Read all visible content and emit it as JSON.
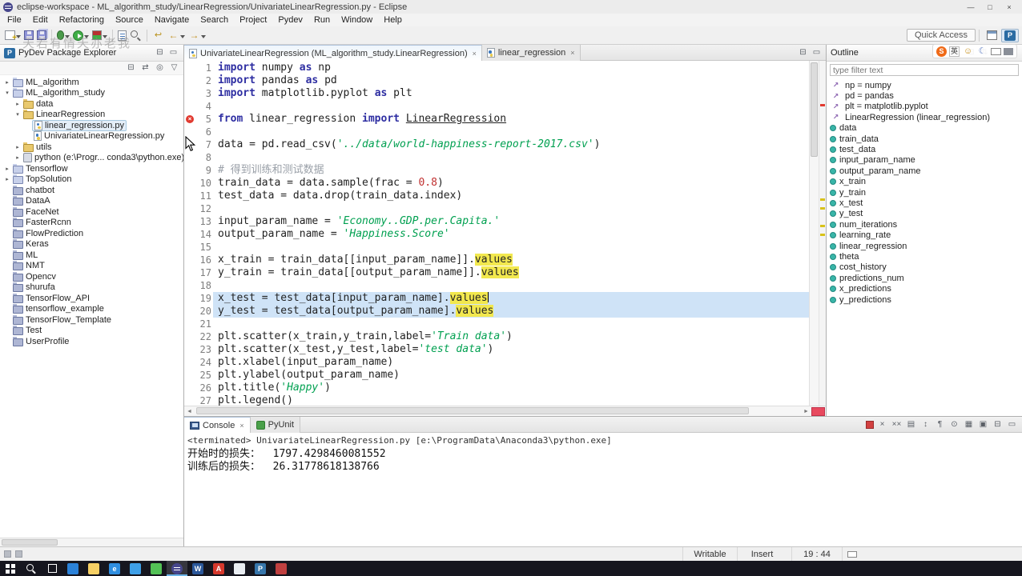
{
  "window": {
    "title": "eclipse-workspace - ML_algorithm_study/LinearRegression/UnivariateLinearRegression.py - Eclipse"
  },
  "menu": {
    "items": [
      "File",
      "Edit",
      "Refactoring",
      "Source",
      "Navigate",
      "Search",
      "Project",
      "Pydev",
      "Run",
      "Window",
      "Help"
    ]
  },
  "toolbar": {
    "quick_access": "Quick Access",
    "items": [
      {
        "name": "new-wizard-icon",
        "caret": true
      },
      {
        "name": "save-icon"
      },
      {
        "name": "save-all-icon"
      },
      {
        "sep": true
      },
      {
        "name": "debug-icon",
        "caret": true
      },
      {
        "name": "run-icon",
        "caret": true
      },
      {
        "name": "coverage-icon",
        "caret": true
      },
      {
        "sep": true
      },
      {
        "name": "new-module-icon"
      },
      {
        "name": "search-icon"
      },
      {
        "sep": true
      },
      {
        "name": "last-edit-icon"
      },
      {
        "name": "back-icon",
        "caret": true
      },
      {
        "name": "forward-icon",
        "caret": true
      }
    ],
    "perspectives": [
      {
        "name": "open-perspective-icon"
      },
      {
        "name": "pydev-perspective-icon",
        "active": true
      }
    ]
  },
  "watermark": "天若有情天亦老我",
  "ime": {
    "language": "英",
    "items": [
      "sogou-logo-icon",
      "language-mode-icon",
      "emoji-icon",
      "night-mode-icon",
      "soft-keyboard-icon",
      "toolbox-icon"
    ]
  },
  "explorer": {
    "title": "PyDev Package Explorer",
    "header_controls": [
      "minimize-view-icon",
      "maximize-view-icon"
    ],
    "toolbar": [
      "collapse-all-icon",
      "link-with-editor-icon",
      "focus-icon",
      "view-menu-icon"
    ],
    "items": [
      {
        "label": "ML_algorithm",
        "level": 0,
        "arrow": "right",
        "icon": "project"
      },
      {
        "label": "ML_algorithm_study",
        "level": 0,
        "arrow": "down",
        "icon": "project"
      },
      {
        "label": "data",
        "level": 1,
        "arrow": "right",
        "icon": "folder"
      },
      {
        "label": "LinearRegression",
        "level": 1,
        "arrow": "down",
        "icon": "folder"
      },
      {
        "label": "linear_regression.py",
        "level": 2,
        "icon": "pyfile",
        "selected": true
      },
      {
        "label": "UnivariateLinearRegression.py",
        "level": 2,
        "icon": "pyfile"
      },
      {
        "label": "utils",
        "level": 1,
        "arrow": "right",
        "icon": "folder"
      },
      {
        "label": "python (e:\\Progr... conda3\\python.exe)",
        "level": 1,
        "arrow": "right",
        "icon": "interpreter"
      },
      {
        "label": "Tensorflow",
        "level": 0,
        "arrow": "right",
        "icon": "project"
      },
      {
        "label": "TopSolution",
        "level": 0,
        "arrow": "right",
        "icon": "project"
      },
      {
        "label": "chatbot",
        "level": 0,
        "icon": "closed"
      },
      {
        "label": "DataA",
        "level": 0,
        "icon": "closed"
      },
      {
        "label": "FaceNet",
        "level": 0,
        "icon": "closed"
      },
      {
        "label": "FasterRcnn",
        "level": 0,
        "icon": "closed"
      },
      {
        "label": "FlowPrediction",
        "level": 0,
        "icon": "closed"
      },
      {
        "label": "Keras",
        "level": 0,
        "icon": "closed"
      },
      {
        "label": "ML",
        "level": 0,
        "icon": "closed"
      },
      {
        "label": "NMT",
        "level": 0,
        "icon": "closed"
      },
      {
        "label": "Opencv",
        "level": 0,
        "icon": "closed"
      },
      {
        "label": "shurufa",
        "level": 0,
        "icon": "closed"
      },
      {
        "label": "TensorFlow_API",
        "level": 0,
        "icon": "closed"
      },
      {
        "label": "tensorflow_example",
        "level": 0,
        "icon": "closed"
      },
      {
        "label": "TensorFlow_Template",
        "level": 0,
        "icon": "closed"
      },
      {
        "label": "Test",
        "level": 0,
        "icon": "closed"
      },
      {
        "label": "UserProfile",
        "level": 0,
        "icon": "closed"
      }
    ]
  },
  "editor": {
    "tabs": [
      {
        "label": "UnivariateLinearRegression (ML_algorithm_study.LinearRegression)",
        "active": true
      },
      {
        "label": "linear_regression",
        "active": false
      }
    ],
    "tab_controls": [
      "minimize-view-icon",
      "maximize-view-icon"
    ],
    "code": {
      "lines": [
        {
          "n": 1,
          "segs": [
            [
              "k",
              "import "
            ],
            [
              "p",
              "numpy "
            ],
            [
              "k",
              "as "
            ],
            [
              "p",
              "np"
            ]
          ]
        },
        {
          "n": 2,
          "segs": [
            [
              "k",
              "import "
            ],
            [
              "p",
              "pandas "
            ],
            [
              "k",
              "as "
            ],
            [
              "p",
              "pd"
            ]
          ]
        },
        {
          "n": 3,
          "segs": [
            [
              "k",
              "import "
            ],
            [
              "p",
              "matplotlib.pyplot "
            ],
            [
              "k",
              "as "
            ],
            [
              "p",
              "plt"
            ]
          ]
        },
        {
          "n": 4,
          "segs": []
        },
        {
          "n": 5,
          "marker": "error",
          "segs": [
            [
              "k",
              "from "
            ],
            [
              "p",
              "linear_regression "
            ],
            [
              "k",
              "import "
            ],
            [
              "u",
              "LinearRegression"
            ]
          ]
        },
        {
          "n": 6,
          "segs": []
        },
        {
          "n": 7,
          "segs": [
            [
              "p",
              "data = pd.read_csv("
            ],
            [
              "s",
              "'../data/world-happiness-report-2017.csv'"
            ],
            [
              "p",
              ")"
            ]
          ]
        },
        {
          "n": 8,
          "segs": []
        },
        {
          "n": 9,
          "segs": [
            [
              "c",
              "# 得到训练和测试数据"
            ]
          ]
        },
        {
          "n": 10,
          "segs": [
            [
              "p",
              "train_data = data.sample(frac = "
            ],
            [
              "n",
              "0.8"
            ],
            [
              "p",
              ")"
            ]
          ]
        },
        {
          "n": 11,
          "segs": [
            [
              "p",
              "test_data = data.drop(train_data.index)"
            ]
          ]
        },
        {
          "n": 12,
          "segs": []
        },
        {
          "n": 13,
          "segs": [
            [
              "p",
              "input_param_name = "
            ],
            [
              "s",
              "'Economy..GDP.per.Capita.'"
            ]
          ]
        },
        {
          "n": 14,
          "segs": [
            [
              "p",
              "output_param_name = "
            ],
            [
              "s",
              "'Happiness.Score'"
            ]
          ]
        },
        {
          "n": 15,
          "segs": []
        },
        {
          "n": 16,
          "segs": [
            [
              "p",
              "x_train = train_data[[input_param_name]]."
            ],
            [
              "v",
              "values"
            ]
          ]
        },
        {
          "n": 17,
          "segs": [
            [
              "p",
              "y_train = train_data[[output_param_name]]."
            ],
            [
              "v",
              "values"
            ]
          ]
        },
        {
          "n": 18,
          "segs": []
        },
        {
          "n": 19,
          "hl": true,
          "cursor": true,
          "segs": [
            [
              "p",
              "x_test = test_data[input_param_name]."
            ],
            [
              "v",
              "values"
            ]
          ]
        },
        {
          "n": 20,
          "hl": true,
          "segs": [
            [
              "p",
              "y_test = test_data[output_param_name]."
            ],
            [
              "v",
              "values"
            ]
          ]
        },
        {
          "n": 21,
          "segs": []
        },
        {
          "n": 22,
          "segs": [
            [
              "p",
              "plt.scatter(x_train,y_train,label="
            ],
            [
              "s",
              "'Train data'"
            ],
            [
              "p",
              ")"
            ]
          ]
        },
        {
          "n": 23,
          "segs": [
            [
              "p",
              "plt.scatter(x_test,y_test,label="
            ],
            [
              "s",
              "'test data'"
            ],
            [
              "p",
              ")"
            ]
          ]
        },
        {
          "n": 24,
          "segs": [
            [
              "p",
              "plt.xlabel(input_param_name)"
            ]
          ]
        },
        {
          "n": 25,
          "segs": [
            [
              "p",
              "plt.ylabel(output_param_name)"
            ]
          ]
        },
        {
          "n": 26,
          "segs": [
            [
              "p",
              "plt.title("
            ],
            [
              "s",
              "'Happy'"
            ],
            [
              "p",
              ")"
            ]
          ]
        },
        {
          "n": 27,
          "segs": [
            [
              "p",
              "plt.legend()"
            ]
          ]
        }
      ]
    }
  },
  "outline": {
    "title": "Outline",
    "toolbar": [
      "collapse-all-icon",
      "sort-icon",
      "hide-fields-icon",
      "view-menu-icon"
    ],
    "filter_placeholder": "type filter text",
    "items": [
      {
        "label": "np = numpy",
        "icon": "import"
      },
      {
        "label": "pd = pandas",
        "icon": "import"
      },
      {
        "label": "plt = matplotlib.pyplot",
        "icon": "import"
      },
      {
        "label": "LinearRegression (linear_regression)",
        "icon": "import"
      },
      {
        "label": "data",
        "icon": "variable"
      },
      {
        "label": "train_data",
        "icon": "variable"
      },
      {
        "label": "test_data",
        "icon": "variable"
      },
      {
        "label": "input_param_name",
        "icon": "variable"
      },
      {
        "label": "output_param_name",
        "icon": "variable"
      },
      {
        "label": "x_train",
        "icon": "variable"
      },
      {
        "label": "y_train",
        "icon": "variable"
      },
      {
        "label": "x_test",
        "icon": "variable"
      },
      {
        "label": "y_test",
        "icon": "variable"
      },
      {
        "label": "num_iterations",
        "icon": "variable"
      },
      {
        "label": "learning_rate",
        "icon": "variable"
      },
      {
        "label": "linear_regression",
        "icon": "variable"
      },
      {
        "label": "theta",
        "icon": "variable"
      },
      {
        "label": "cost_history",
        "icon": "variable"
      },
      {
        "label": "predictions_num",
        "icon": "variable"
      },
      {
        "label": "x_predictions",
        "icon": "variable"
      },
      {
        "label": "y_predictions",
        "icon": "variable"
      }
    ]
  },
  "console": {
    "tabs": [
      {
        "label": "Console",
        "active": true
      },
      {
        "label": "PyUnit",
        "active": false
      }
    ],
    "toolbar": [
      "terminate-icon",
      "remove-launch-icon",
      "remove-all-launches-icon",
      "clear-console-icon",
      "scroll-lock-icon",
      "word-wrap-icon",
      "pin-console-icon",
      "display-selected-console-icon",
      "open-console-icon",
      "minimize-view-icon",
      "maximize-view-icon"
    ],
    "terminated_line": "<terminated> UnivariateLinearRegression.py [e:\\ProgramData\\Anaconda3\\python.exe]",
    "output": [
      "开始时的损失：  1797.4298460081552",
      "训练后的损失：  26.31778618138766"
    ]
  },
  "statusbar": {
    "writable": "Writable",
    "insert": "Insert",
    "position": "19 : 44"
  },
  "taskbar": {
    "items": [
      {
        "name": "start-button"
      },
      {
        "name": "search-button"
      },
      {
        "name": "task-view-button"
      },
      {
        "name": "qq-icon",
        "color": "#2b82d9"
      },
      {
        "name": "file-explorer-icon",
        "color": "#f7d065"
      },
      {
        "name": "edge-icon",
        "color": "#2f8ee0",
        "glyph": "e"
      },
      {
        "name": "vscode-icon",
        "color": "#3fa0e8"
      },
      {
        "name": "wechat-icon",
        "color": "#53c156"
      },
      {
        "name": "eclipse-taskbar-icon",
        "color": "#46468c",
        "active": true
      },
      {
        "name": "word-icon",
        "color": "#2b579a",
        "glyph": "W"
      },
      {
        "name": "pdf-icon",
        "color": "#d6382c",
        "glyph": "A"
      },
      {
        "name": "notepad-icon",
        "color": "#e9edf2"
      },
      {
        "name": "pycharm-icon",
        "color": "#3776ab",
        "glyph": "P"
      },
      {
        "name": "app-red-icon",
        "color": "#c04040"
      }
    ]
  },
  "colors": {
    "keyword": "#2e2ea2",
    "string": "#00a050",
    "number": "#c03030",
    "comment": "#9aa0a8",
    "occurrence": "#f2e84e",
    "selection-line": "#cfe3f7",
    "error": "#e13a30",
    "taskbar-bg": "#16161f"
  }
}
